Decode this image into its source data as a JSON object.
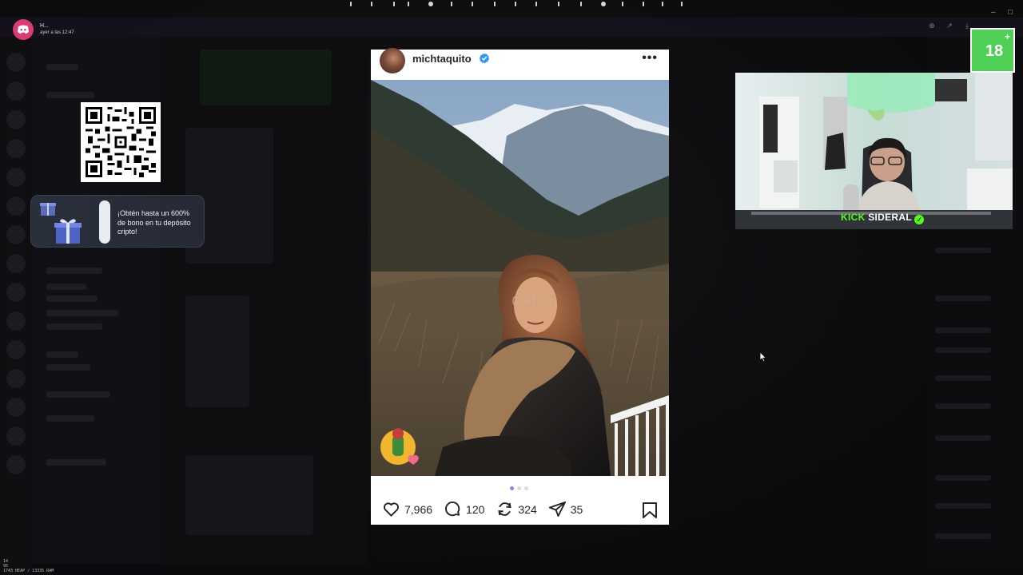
{
  "notification": {
    "name": "H...",
    "time": "ayer a las 12:47"
  },
  "promo": {
    "text": "¡Obtén hasta un 600% de bono en tu depósito cripto!"
  },
  "post": {
    "username": "michtaquito",
    "verified": true,
    "likes": "7,966",
    "comments": "120",
    "reposts": "324",
    "shares": "35",
    "carousel": {
      "total": 3,
      "active": 1
    }
  },
  "webcam": {
    "kick_label_green": "KICK",
    "kick_label_white": "SIDERAL"
  },
  "age_badge": "18",
  "perf": {
    "line1": "14",
    "line2": "95",
    "line3": "1743 HEAP / 13335 RAM"
  },
  "colors": {
    "kick_green": "#53fc18",
    "verified_blue": "#3897f0",
    "badge_green": "#4fcf55",
    "notif_pink": "#d93b73"
  }
}
